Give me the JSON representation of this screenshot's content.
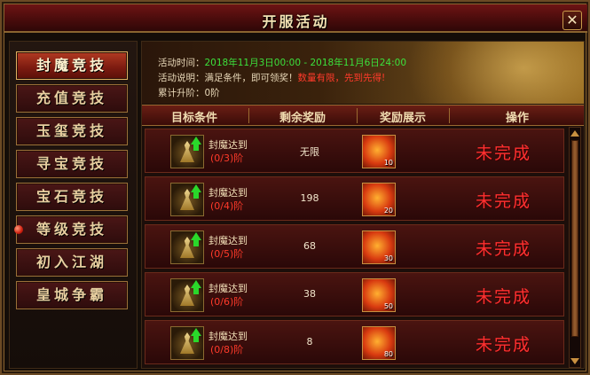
{
  "window": {
    "title": "开服活动",
    "close_label": "✕"
  },
  "sidebar": {
    "items": [
      {
        "label": "封魔竞技",
        "active": true
      },
      {
        "label": "充值竞技"
      },
      {
        "label": "玉玺竞技"
      },
      {
        "label": "寻宝竞技"
      },
      {
        "label": "宝石竞技"
      },
      {
        "label": "等级竞技",
        "has_notice": true
      },
      {
        "label": "初入江湖"
      },
      {
        "label": "皇城争霸"
      }
    ]
  },
  "banner": {
    "time_label": "活动时间：",
    "time_value": "2018年11月3日00:00 - 2018年11月6日24:00",
    "desc_label": "活动说明：满足条件，即可领奖！",
    "desc_highlight": "数量有限，先到先得!",
    "accum_label": "累计升阶：",
    "accum_value": "0阶"
  },
  "table": {
    "headers": [
      "目标条件",
      "剩余奖励",
      "奖励展示",
      "操作"
    ],
    "rows": [
      {
        "condition": "封魔达到",
        "progress": "(0/3)阶",
        "remaining": "无限",
        "reward_count": "10",
        "action": "未完成"
      },
      {
        "condition": "封魔达到",
        "progress": "(0/4)阶",
        "remaining": "198",
        "reward_count": "20",
        "action": "未完成"
      },
      {
        "condition": "封魔达到",
        "progress": "(0/5)阶",
        "remaining": "68",
        "reward_count": "30",
        "action": "未完成"
      },
      {
        "condition": "封魔达到",
        "progress": "(0/6)阶",
        "remaining": "38",
        "reward_count": "50",
        "action": "未完成"
      },
      {
        "condition": "封魔达到",
        "progress": "(0/8)阶",
        "remaining": "8",
        "reward_count": "80",
        "action": "未完成"
      }
    ]
  },
  "icons": {
    "condition": "level-up-figure-icon",
    "reward": "reward-item-icon",
    "close": "close-icon"
  }
}
